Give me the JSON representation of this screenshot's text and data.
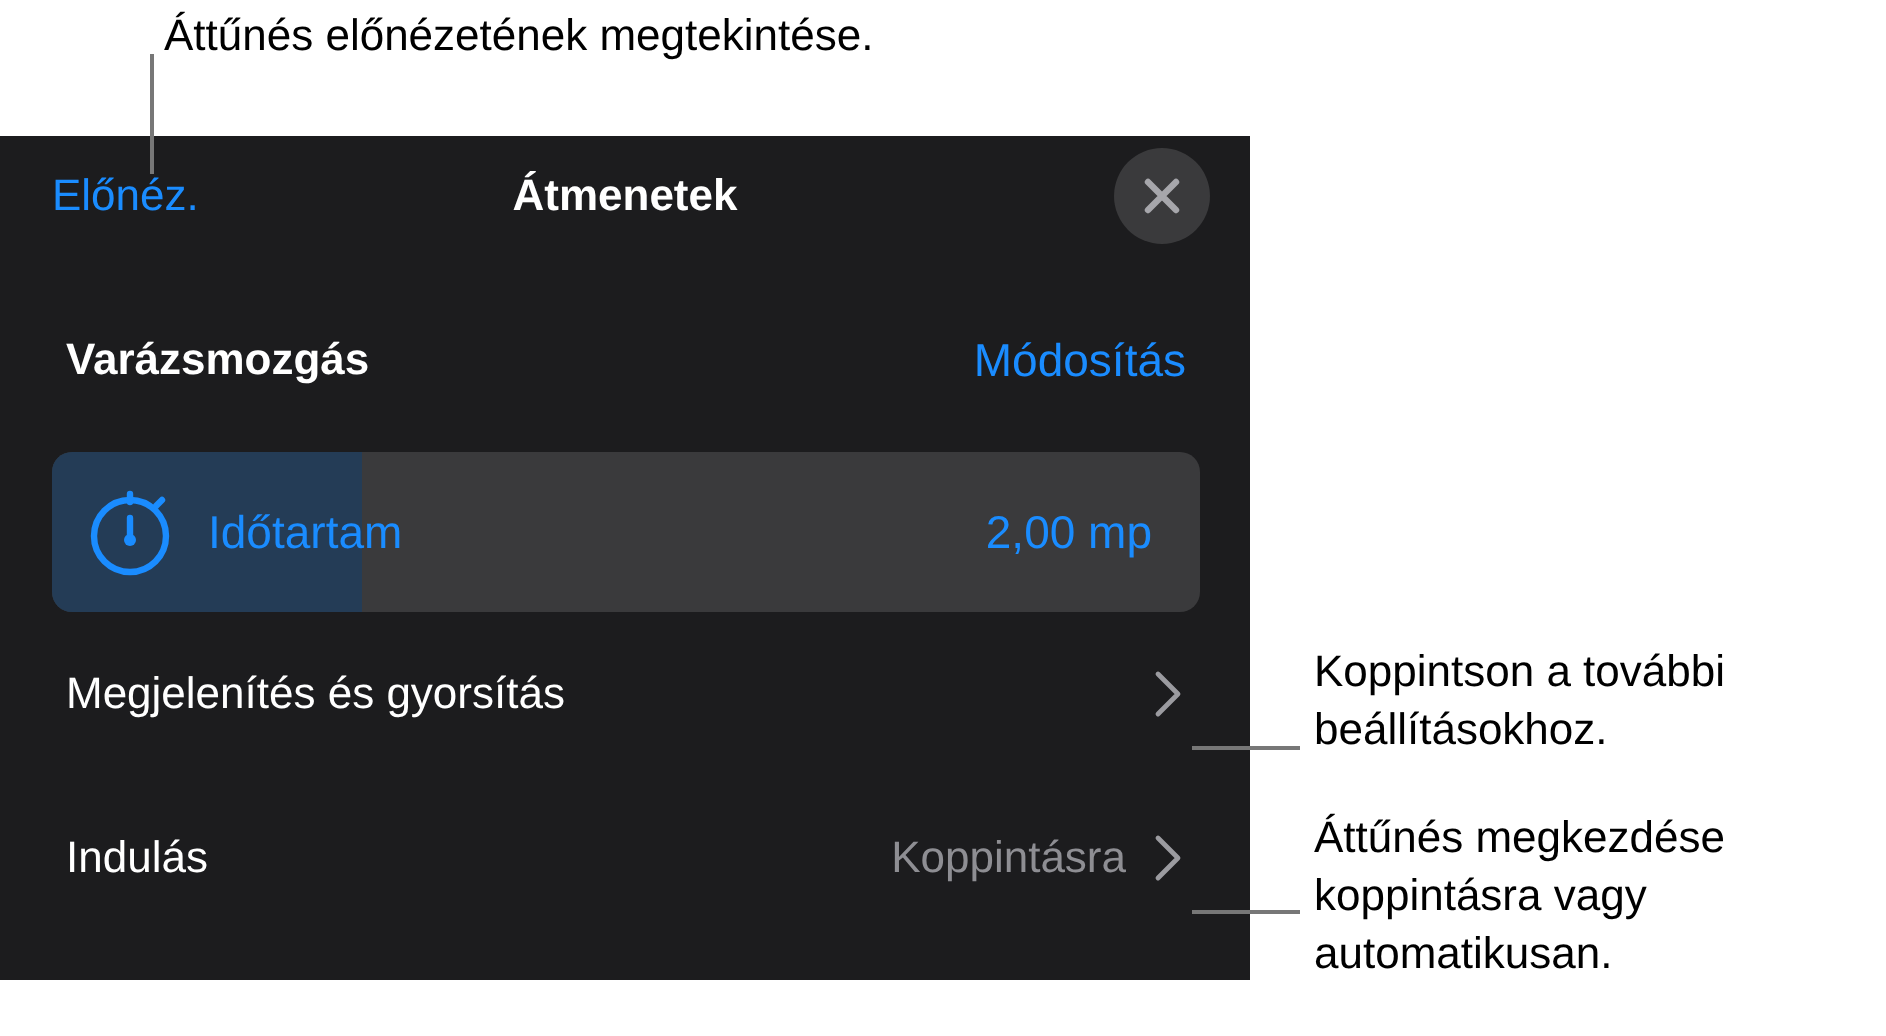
{
  "annotations": [
    {
      "text": "Áttűnés előnézetének megtekintése."
    },
    {
      "text": "Koppintson a további\nbeállításokhoz."
    },
    {
      "text": "Áttűnés megkezdése\nkoppintásra vagy\nautomatikusan."
    }
  ],
  "panel": {
    "preview": "Előnéz.",
    "title": "Átmenetek",
    "effect": {
      "name": "Varázsmozgás",
      "action": "Módosítás"
    },
    "duration": {
      "label": "Időtartam",
      "reading": "2,00 mp",
      "level": 0.27
    },
    "rows": [
      {
        "label": "Megjelenítés és gyorsítás"
      },
      {
        "label": "Indulás",
        "value": "Koppintásra"
      }
    ]
  }
}
